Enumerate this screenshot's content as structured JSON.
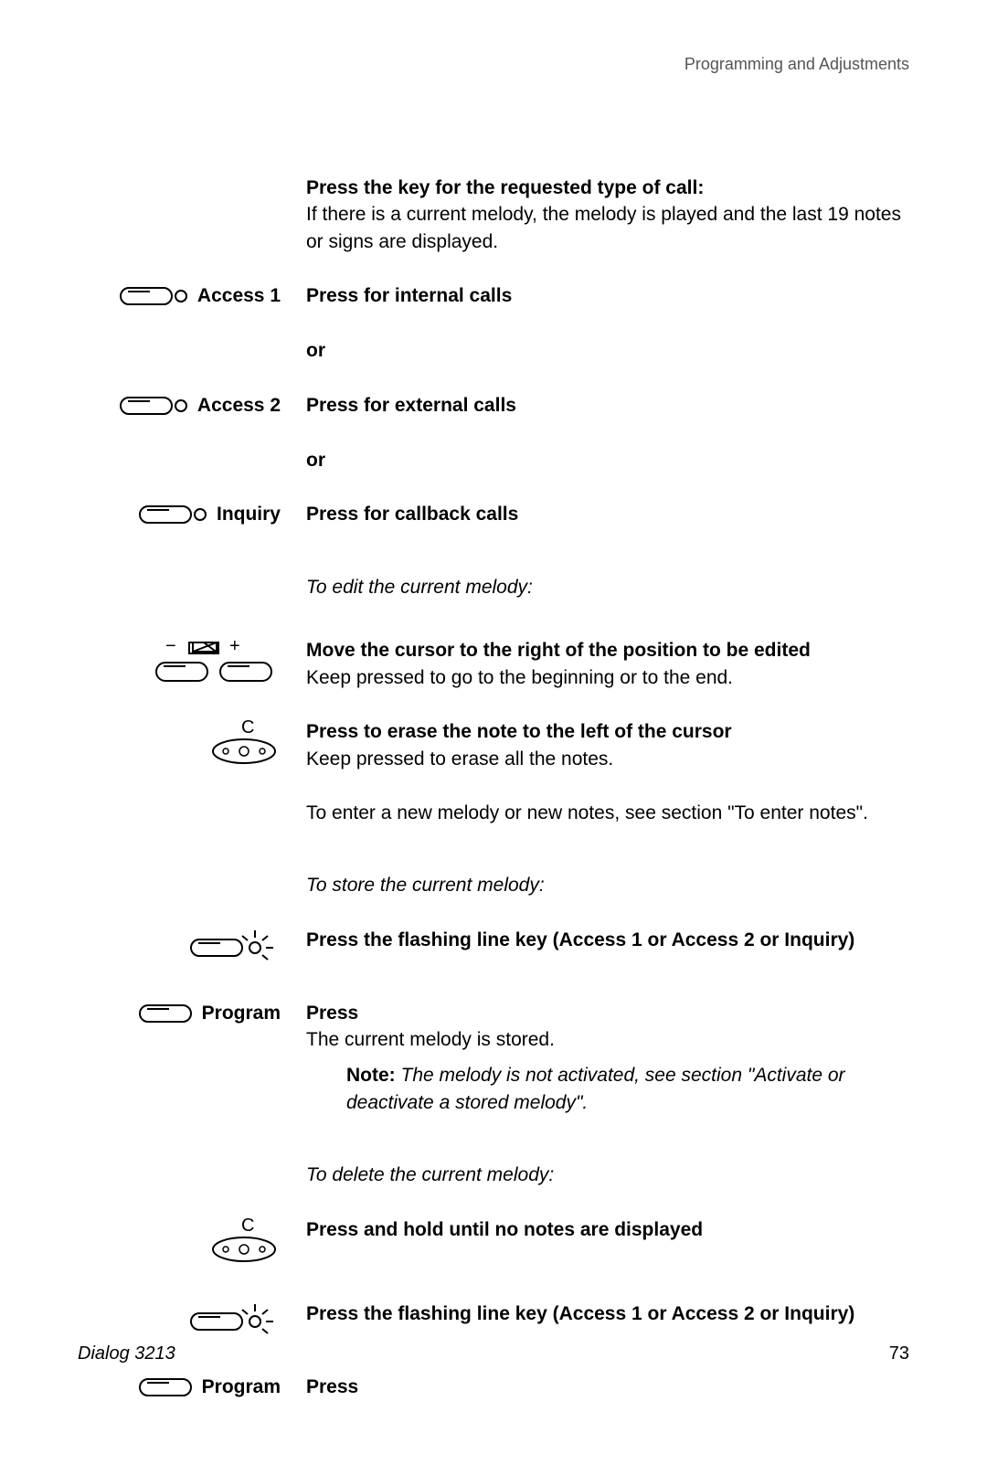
{
  "header": {
    "section": "Programming and Adjustments"
  },
  "intro": {
    "bold": "Press the key for the requested type of call:",
    "body": "If there is a current melody, the melody is played and the last 19 notes or signs are displayed."
  },
  "access1": {
    "label": "Access 1",
    "instr": "Press for internal calls"
  },
  "or1": {
    "text": "or"
  },
  "access2": {
    "label": "Access 2",
    "instr": "Press for external calls"
  },
  "or2": {
    "text": "or"
  },
  "inquiry": {
    "label": "Inquiry",
    "instr": "Press for callback calls"
  },
  "edit_heading": {
    "text": "To edit the current melody:"
  },
  "move_cursor": {
    "bold": "Move the cursor to the right of the position to be edited",
    "body": "Keep pressed to go to the beginning or to the end."
  },
  "erase": {
    "bold": "Press to erase the note to the left of the cursor",
    "body": "Keep pressed to erase all the notes."
  },
  "enter_new": {
    "text": "To enter a new melody or new notes, see section \"To enter notes\"."
  },
  "store_heading": {
    "text": "To store the current melody:"
  },
  "flashing1": {
    "text": "Press the flashing line key (Access 1 or Access 2 or Inquiry)"
  },
  "program1": {
    "label": "Program",
    "bold": "Press",
    "body": "The current melody is stored."
  },
  "note": {
    "label": "Note:",
    "text": " The melody is not activated, see section \"Activate or deactivate a stored melody\"."
  },
  "delete_heading": {
    "text": "To delete the current melody:"
  },
  "press_hold": {
    "text": "Press and hold until no notes are displayed"
  },
  "flashing2": {
    "text": "Press the flashing line key (Access 1 or Access 2 or Inquiry)"
  },
  "program2": {
    "label": "Program",
    "bold": "Press"
  },
  "footer": {
    "left": "Dialog 3213",
    "right": "73"
  },
  "icons": {
    "c_label": "C",
    "minus": "−",
    "plus": "+"
  }
}
